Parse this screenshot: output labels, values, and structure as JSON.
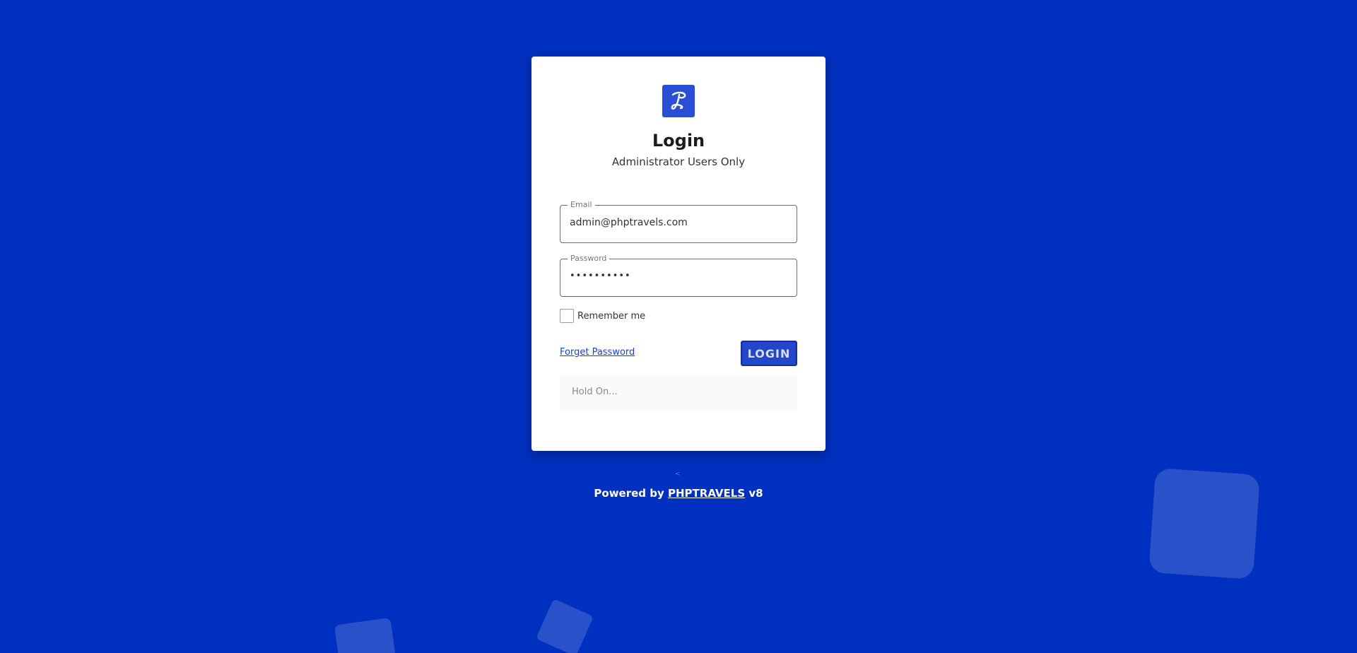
{
  "colors": {
    "background": "#0030bf",
    "accent": "#2446c9",
    "link": "#1a3fcf"
  },
  "logo": {
    "icon": "phptravels-logo-icon"
  },
  "login": {
    "title": "Login",
    "subtitle": "Administrator Users Only",
    "email": {
      "label": "Email",
      "value": "admin@phptravels.com"
    },
    "password": {
      "label": "Password",
      "value": "••••••••••"
    },
    "remember": {
      "label": "Remember me",
      "checked": false
    },
    "forgot_label": "Forget Password",
    "login_button": "LOGIN",
    "status": "Hold On..."
  },
  "footer": {
    "prefix": "Powered by",
    "brand": "PHPTRAVELS",
    "version": "v8"
  }
}
